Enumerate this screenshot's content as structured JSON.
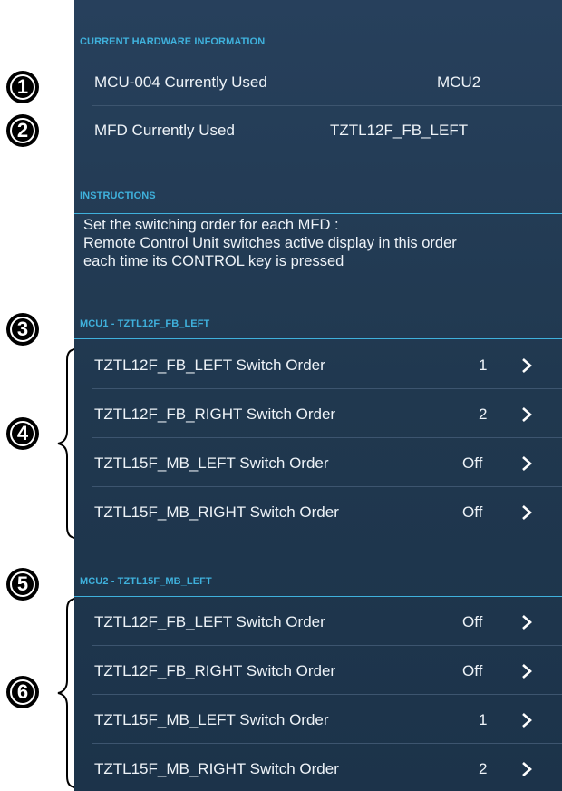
{
  "hardware": {
    "title": "CURRENT HARDWARE INFORMATION",
    "rows": [
      {
        "label": "MCU-004 Currently Used",
        "value": "MCU2"
      },
      {
        "label": "MFD Currently Used",
        "value": "TZTL12F_FB_LEFT"
      }
    ]
  },
  "instructions": {
    "title": "INSTRUCTIONS",
    "text": "Set the switching order for each MFD :\nRemote Control Unit switches active display in this order\neach time its CONTROL key is pressed"
  },
  "mcu1": {
    "title": "MCU1 - TZTL12F_FB_LEFT",
    "rows": [
      {
        "label": "TZTL12F_FB_LEFT Switch Order",
        "value": "1"
      },
      {
        "label": "TZTL12F_FB_RIGHT Switch Order",
        "value": "2"
      },
      {
        "label": "TZTL15F_MB_LEFT Switch Order",
        "value": "Off"
      },
      {
        "label": "TZTL15F_MB_RIGHT Switch Order",
        "value": "Off"
      }
    ]
  },
  "mcu2": {
    "title": "MCU2 - TZTL15F_MB_LEFT",
    "rows": [
      {
        "label": "TZTL12F_FB_LEFT Switch Order",
        "value": "Off"
      },
      {
        "label": "TZTL12F_FB_RIGHT Switch Order",
        "value": "Off"
      },
      {
        "label": "TZTL15F_MB_LEFT Switch Order",
        "value": "1"
      },
      {
        "label": "TZTL15F_MB_RIGHT Switch Order",
        "value": "2"
      }
    ]
  },
  "callouts": [
    "1",
    "2",
    "3",
    "4",
    "5",
    "6"
  ],
  "colors": {
    "accent": "#3fb1dc",
    "panel": "#223a54",
    "text": "#eef3f8"
  },
  "icons": {
    "row_arrow": "chevron-right-icon"
  }
}
